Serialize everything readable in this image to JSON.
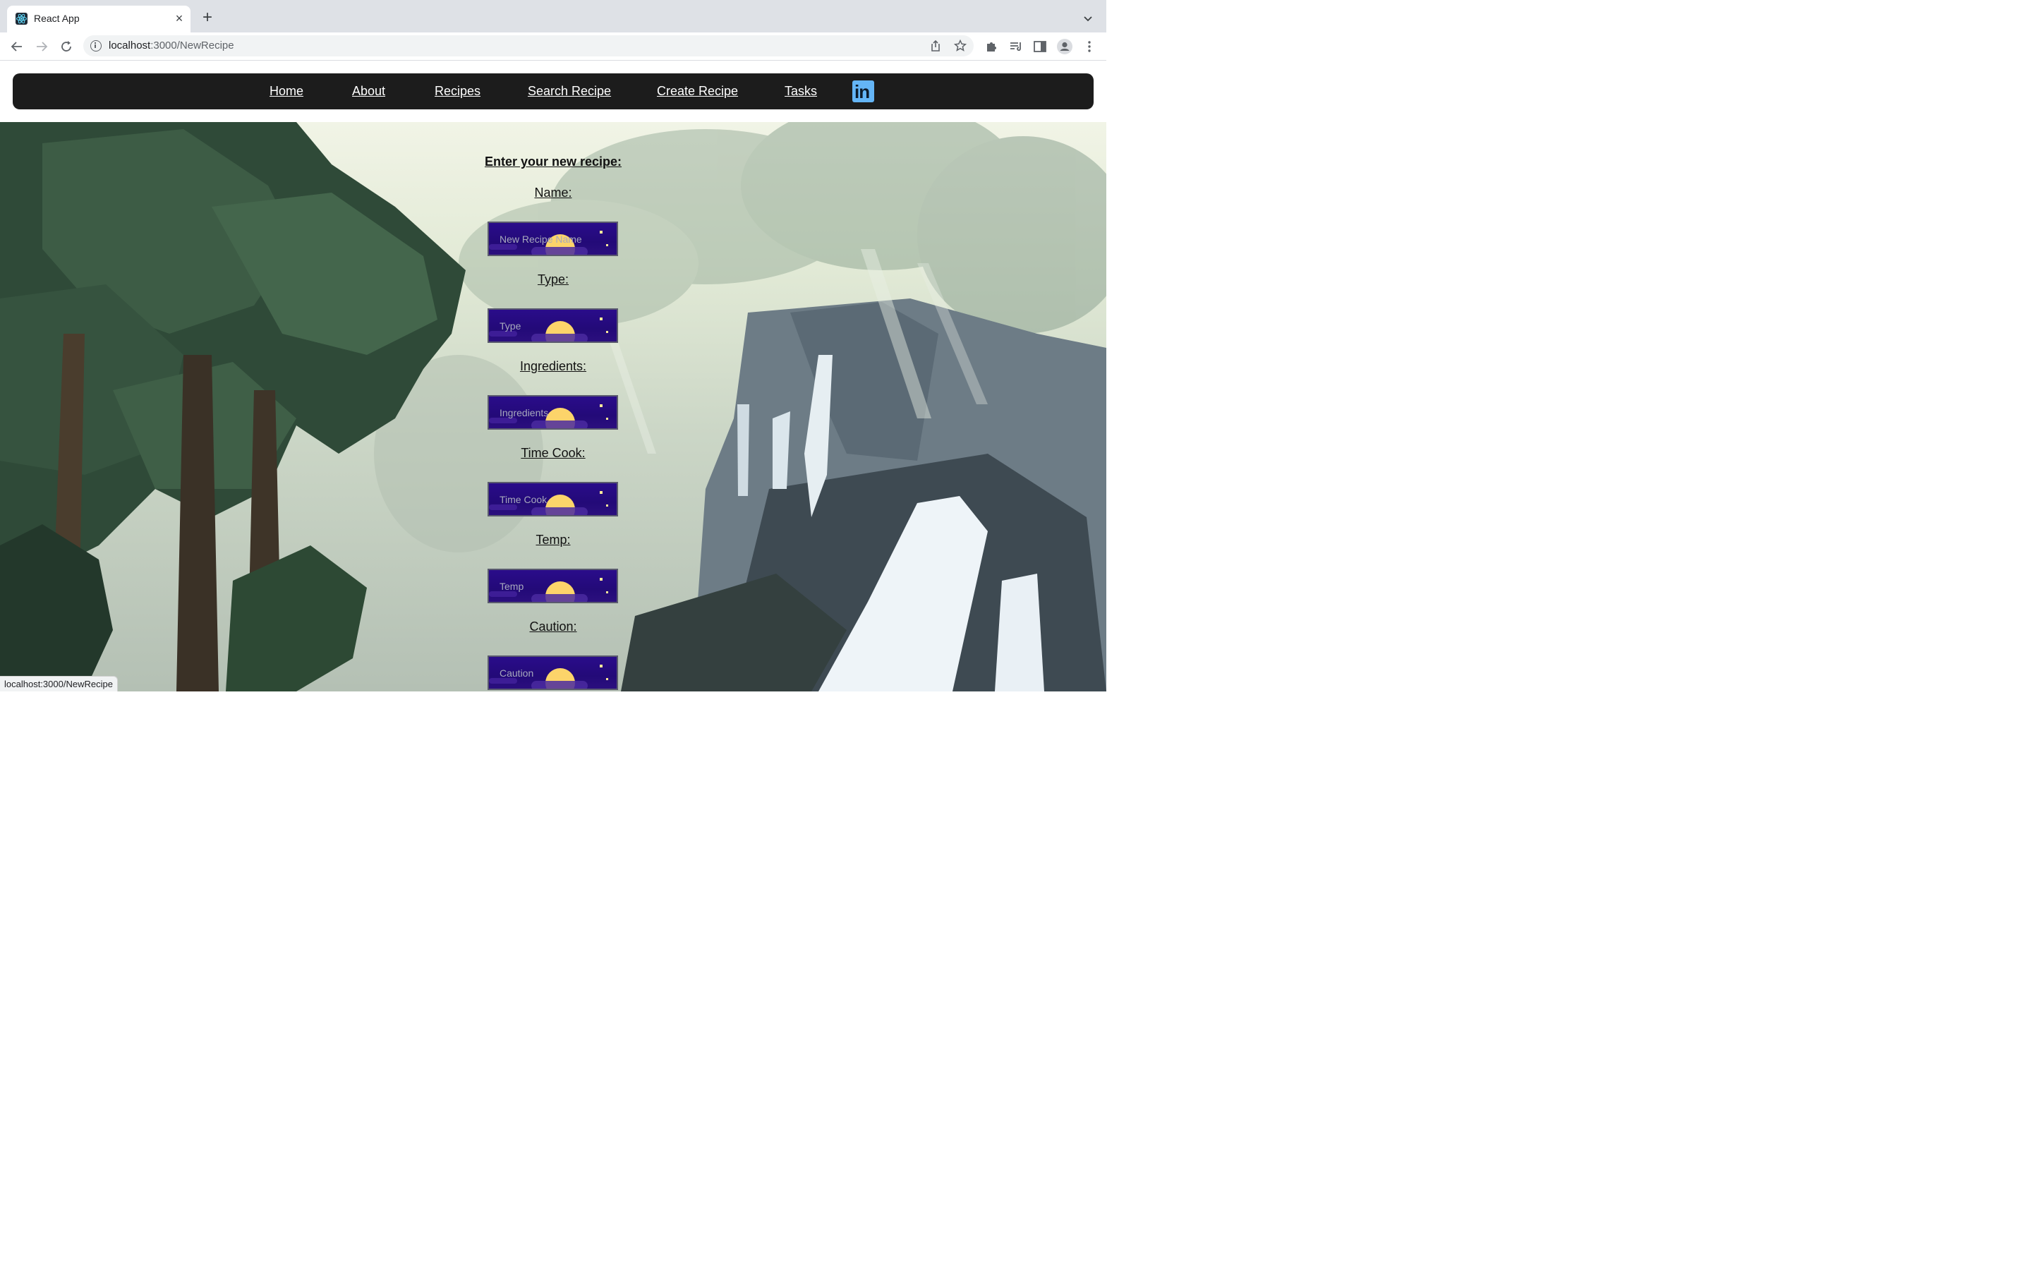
{
  "browser": {
    "tab_title": "React App",
    "tab_close": "×",
    "new_tab": "+",
    "url_host": "localhost",
    "url_path": ":3000/NewRecipe",
    "status_text": "localhost:3000/NewRecipe"
  },
  "nav": {
    "items": [
      {
        "label": "Home"
      },
      {
        "label": "About"
      },
      {
        "label": "Recipes"
      },
      {
        "label": "Search Recipe"
      },
      {
        "label": "Create Recipe"
      },
      {
        "label": "Tasks"
      }
    ],
    "linkedin_label": "in"
  },
  "form": {
    "title": "Enter your new recipe:",
    "fields": [
      {
        "label": "Name:",
        "placeholder": "New Recipe Name"
      },
      {
        "label": "Type:",
        "placeholder": "Type"
      },
      {
        "label": "Ingredients:",
        "placeholder": "Ingredients"
      },
      {
        "label": "Time Cook:",
        "placeholder": "Time Cook"
      },
      {
        "label": "Temp:",
        "placeholder": "Temp"
      },
      {
        "label": "Caution:",
        "placeholder": "Caution"
      }
    ]
  },
  "colors": {
    "navbar_bg": "#1c1c1c",
    "field_bg": "#2a0c8a",
    "moon": "#fcd46a",
    "linkedin": "#64b5f6"
  }
}
